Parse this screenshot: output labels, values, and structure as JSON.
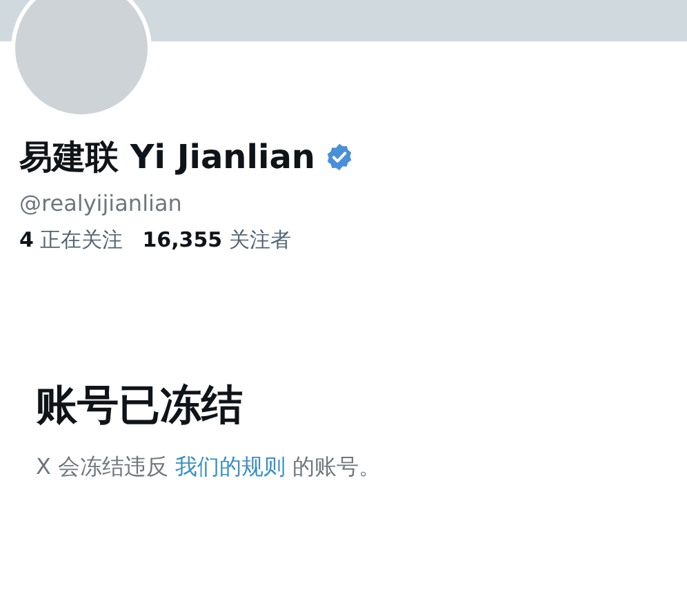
{
  "profile": {
    "display_name": "易建联 Yi Jianlian",
    "verified": true,
    "handle": "@realyijianlian"
  },
  "stats": [
    {
      "count": "4",
      "label": "正在关注"
    },
    {
      "count": "16,355",
      "label": "关注者"
    }
  ],
  "notice": {
    "title": "账号已冻结",
    "message_before": "X 会冻结违反",
    "link": "我们的规则",
    "message_after": "的账号。"
  }
}
